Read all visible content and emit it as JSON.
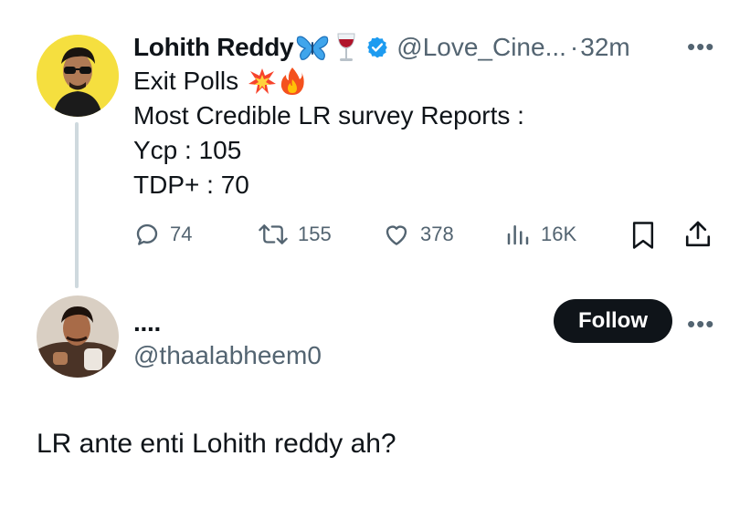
{
  "tweet": {
    "author_name": "Lohith Reddy",
    "handle": "@Love_Cine...",
    "time": "32m",
    "line1": "Exit Polls",
    "line2": "Most Credible LR survey Reports :",
    "line3": "Ycp : 105",
    "line4": "TDP+ : 70",
    "replies": "74",
    "retweets": "155",
    "likes": "378",
    "views": "16K"
  },
  "reply": {
    "author_name": "....",
    "handle": "@thaalabheem0",
    "follow_label": "Follow",
    "text": "LR ante enti Lohith reddy ah?"
  },
  "icons": {
    "more": "more-options-icon",
    "verified": "verified-badge-icon",
    "reply": "reply-icon",
    "retweet": "retweet-icon",
    "like": "heart-icon",
    "views": "views-icon",
    "bookmark": "bookmark-icon",
    "share": "share-icon"
  },
  "colors": {
    "verified": "#1d9bf0",
    "text": "#0f1419",
    "secondary": "#536471",
    "thread_line": "#cfd9de"
  }
}
